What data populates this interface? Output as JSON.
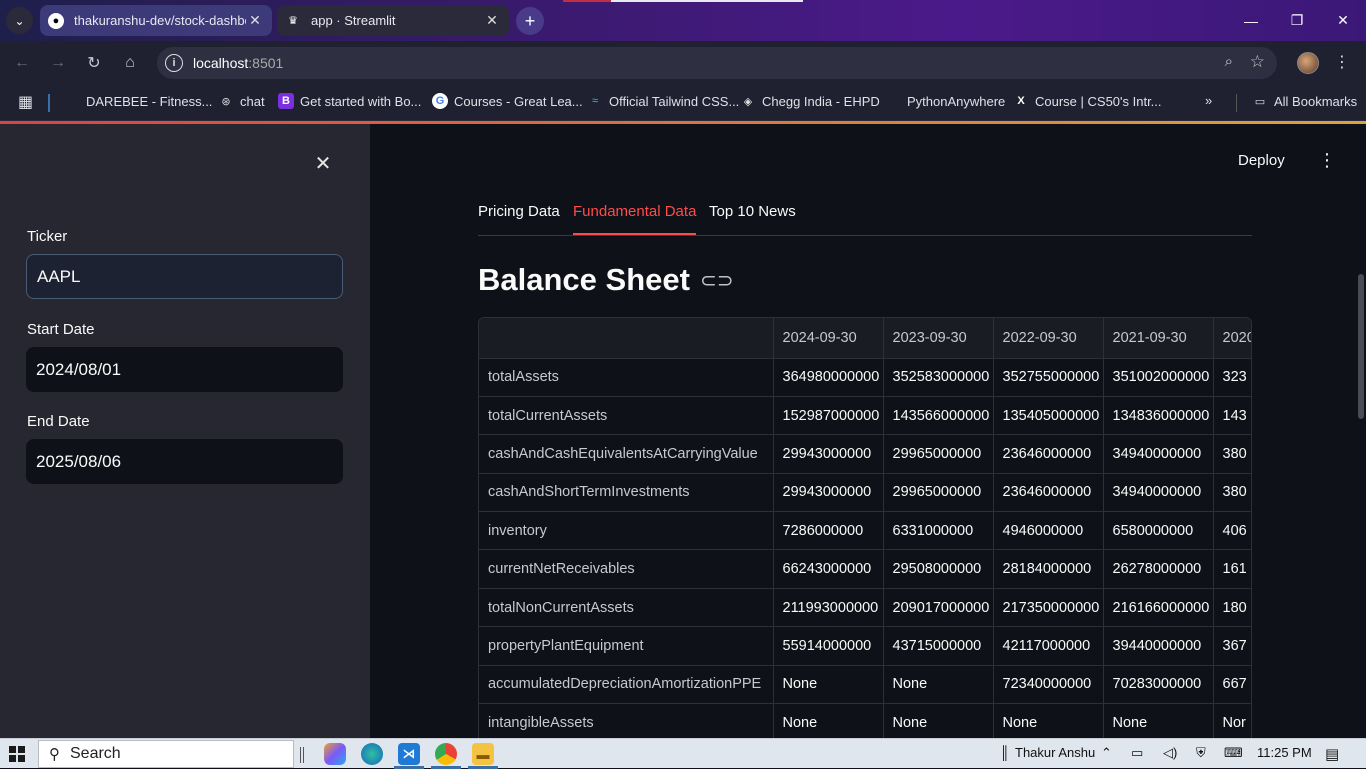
{
  "browser": {
    "tabs": [
      {
        "title": "thakuranshu-dev/stock-dashbo",
        "icon": "github-icon",
        "active": false
      },
      {
        "title": "app · Streamlit",
        "icon": "streamlit-icon",
        "active": true
      }
    ],
    "address": {
      "host": "localhost",
      "port": ":8501"
    },
    "bookmarks": [
      {
        "label": "DAREBEE - Fitness...",
        "icon": "darebee-icon"
      },
      {
        "label": "chat",
        "icon": "chatgpt-icon"
      },
      {
        "label": "Get started with Bo...",
        "icon": "bootstrap-icon"
      },
      {
        "label": "Courses - Great Lea...",
        "icon": "google-icon"
      },
      {
        "label": "Official Tailwind CSS...",
        "icon": "tailwind-icon"
      },
      {
        "label": "Chegg India - EHPD",
        "icon": "chegg-icon"
      },
      {
        "label": "PythonAnywhere",
        "icon": "pythonanywhere-icon"
      },
      {
        "label": "Course | CS50's Intr...",
        "icon": "x-icon"
      }
    ],
    "all_bookmarks": "All Bookmarks"
  },
  "sidebar": {
    "fields": [
      {
        "label": "Ticker",
        "value": "AAPL"
      },
      {
        "label": "Start Date",
        "value": "2024/08/01"
      },
      {
        "label": "End Date",
        "value": "2025/08/06"
      }
    ]
  },
  "main": {
    "deploy_label": "Deploy",
    "tabs": [
      "Pricing Data",
      "Fundamental Data",
      "Top 10 News"
    ],
    "active_tab": "Fundamental Data",
    "heading": "Balance Sheet",
    "table": {
      "columns": [
        "",
        "2024-09-30",
        "2023-09-30",
        "2022-09-30",
        "2021-09-30",
        "2020"
      ],
      "rows": [
        [
          "totalAssets",
          "364980000000",
          "352583000000",
          "352755000000",
          "351002000000",
          "323"
        ],
        [
          "totalCurrentAssets",
          "152987000000",
          "143566000000",
          "135405000000",
          "134836000000",
          "143"
        ],
        [
          "cashAndCashEquivalentsAtCarryingValue",
          "29943000000",
          "29965000000",
          "23646000000",
          "34940000000",
          "380"
        ],
        [
          "cashAndShortTermInvestments",
          "29943000000",
          "29965000000",
          "23646000000",
          "34940000000",
          "380"
        ],
        [
          "inventory",
          "7286000000",
          "6331000000",
          "4946000000",
          "6580000000",
          "406"
        ],
        [
          "currentNetReceivables",
          "66243000000",
          "29508000000",
          "28184000000",
          "26278000000",
          "161"
        ],
        [
          "totalNonCurrentAssets",
          "211993000000",
          "209017000000",
          "217350000000",
          "216166000000",
          "180"
        ],
        [
          "propertyPlantEquipment",
          "55914000000",
          "43715000000",
          "42117000000",
          "39440000000",
          "367"
        ],
        [
          "accumulatedDepreciationAmortizationPPE",
          "None",
          "None",
          "72340000000",
          "70283000000",
          "667"
        ],
        [
          "intangibleAssets",
          "None",
          "None",
          "None",
          "None",
          "Nor"
        ]
      ]
    }
  },
  "taskbar": {
    "search_label": "Search",
    "user": "Thakur Anshu",
    "time": "11:25 PM"
  }
}
